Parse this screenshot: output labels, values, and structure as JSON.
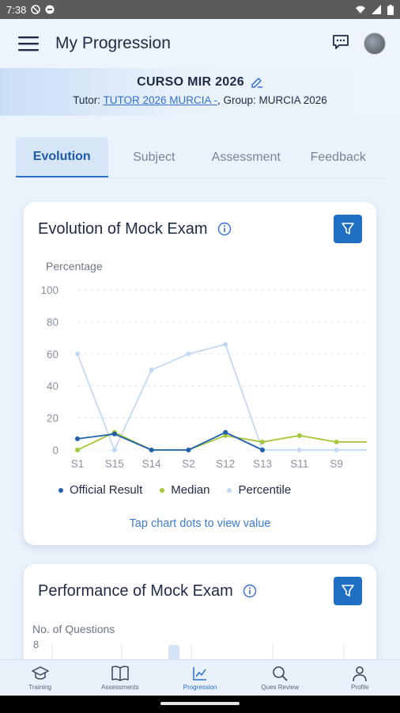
{
  "status_bar": {
    "time": "7:38"
  },
  "app_bar": {
    "title": "My Progression"
  },
  "course": {
    "title": "CURSO MIR 2026",
    "tutor_prefix": "Tutor: ",
    "tutor_name": "TUTOR 2026 MURCIA -",
    "group_text": ", Group: MURCIA 2026"
  },
  "tabs": [
    {
      "label": "Evolution",
      "active": true
    },
    {
      "label": "Subject",
      "active": false
    },
    {
      "label": "Assessment",
      "active": false
    },
    {
      "label": "Feedback",
      "active": false
    }
  ],
  "evolution_card": {
    "title": "Evolution of Mock Exam",
    "hint": "Tap chart dots to view value"
  },
  "performance_card": {
    "title": "Performance of Mock Exam",
    "ylabel": "No. of Questions",
    "first_tick": "8"
  },
  "chart_data": {
    "type": "line",
    "title": "Evolution of Mock Exam",
    "ylabel": "Percentage",
    "xlabel": "",
    "ylim": [
      0,
      100
    ],
    "yticks": [
      0,
      20,
      40,
      60,
      80,
      100
    ],
    "grid": true,
    "legend_placement": "bottom",
    "categories": [
      "S1",
      "S15",
      "S14",
      "S2",
      "S12",
      "S13",
      "S11",
      "S9"
    ],
    "series": [
      {
        "name": "Official Result",
        "color": "#1f5fae",
        "values": [
          7,
          10,
          0,
          0,
          11,
          0,
          null,
          null
        ]
      },
      {
        "name": "Median",
        "color": "#a5c83a",
        "values": [
          0,
          11,
          0,
          0,
          9,
          5,
          9,
          5
        ],
        "extra_tail": 5
      },
      {
        "name": "Percentile",
        "color": "#c3d9f3",
        "values": [
          60,
          0,
          50,
          60,
          66,
          0,
          0,
          0
        ],
        "extra_tail": 0
      }
    ]
  },
  "bottom_nav": [
    {
      "label": "Training",
      "icon": "graduation-cap-icon",
      "active": false
    },
    {
      "label": "Assessments",
      "icon": "book-icon",
      "active": false
    },
    {
      "label": "Progression",
      "icon": "chart-icon",
      "active": true
    },
    {
      "label": "Ques Review",
      "icon": "search-icon",
      "active": false
    },
    {
      "label": "Profile",
      "icon": "person-icon",
      "active": false
    }
  ],
  "colors": {
    "accent": "#1f6fc5",
    "link": "#2f6fd0",
    "background": "#eaf2fb"
  }
}
